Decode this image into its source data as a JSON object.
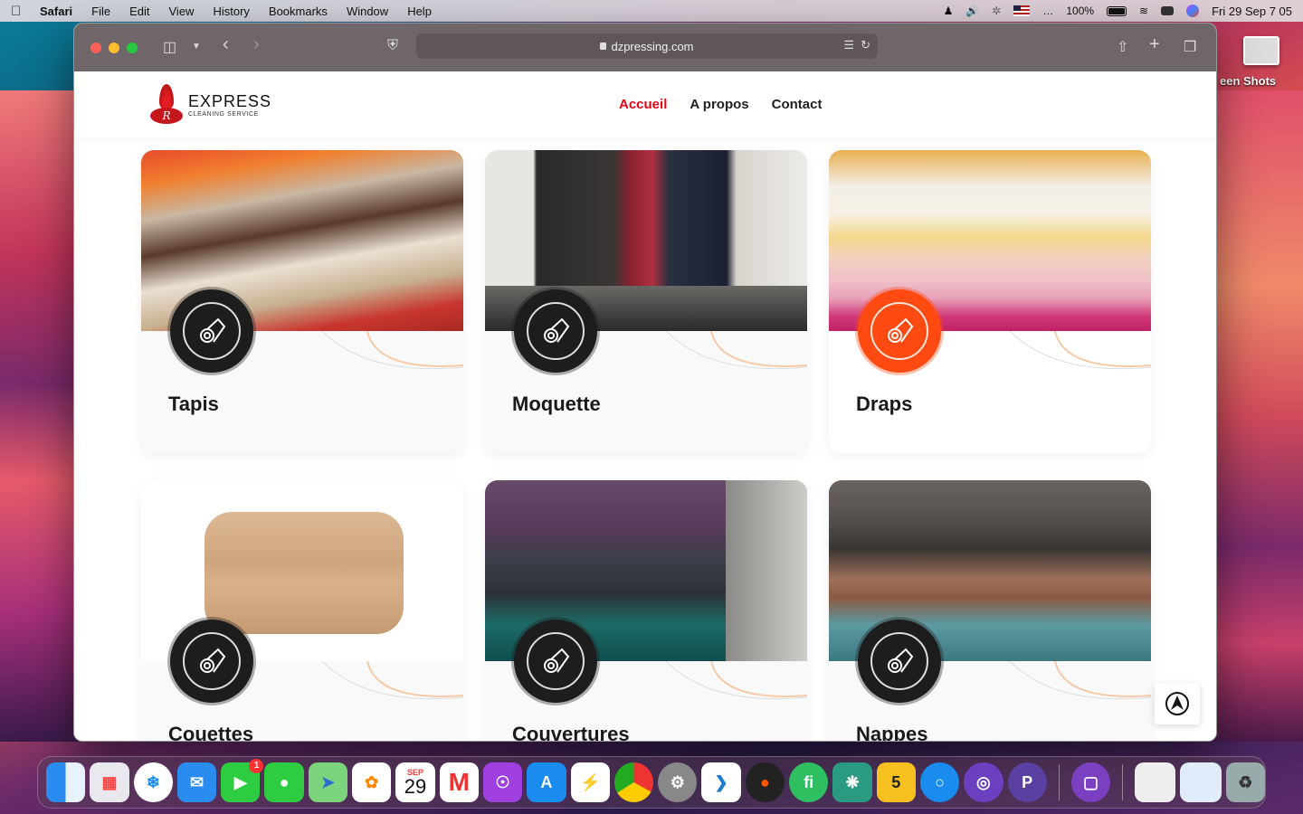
{
  "menubar": {
    "app": "Safari",
    "items": [
      "File",
      "Edit",
      "View",
      "History",
      "Bookmarks",
      "Window",
      "Help"
    ],
    "battery": "100%",
    "datetime": "Fri 29 Sep  7 05"
  },
  "desktop": {
    "screenshots_label": "een Shots"
  },
  "browser": {
    "url": "dzpressing.com"
  },
  "site": {
    "logo": {
      "name": "EXPRESS",
      "tagline": "CLEANING SERVICE",
      "letter": "R"
    },
    "nav": [
      {
        "label": "Accueil",
        "active": true
      },
      {
        "label": "A propos",
        "active": false
      },
      {
        "label": "Contact",
        "active": false
      }
    ],
    "services": [
      {
        "title": "Tapis",
        "highlighted": false
      },
      {
        "title": "Moquette",
        "highlighted": false
      },
      {
        "title": "Draps",
        "highlighted": true
      },
      {
        "title": "Couettes",
        "highlighted": false
      },
      {
        "title": "Couvertures",
        "highlighted": false
      },
      {
        "title": "Nappes",
        "highlighted": false
      }
    ]
  },
  "dock": {
    "calendar_month": "SEP",
    "calendar_day": "29",
    "facetime_badge": "1",
    "app5_label": "5"
  },
  "colors": {
    "accent": "#e30613",
    "badge_highlight": "#ff4a12",
    "badge_dark": "#1d1d1d"
  }
}
